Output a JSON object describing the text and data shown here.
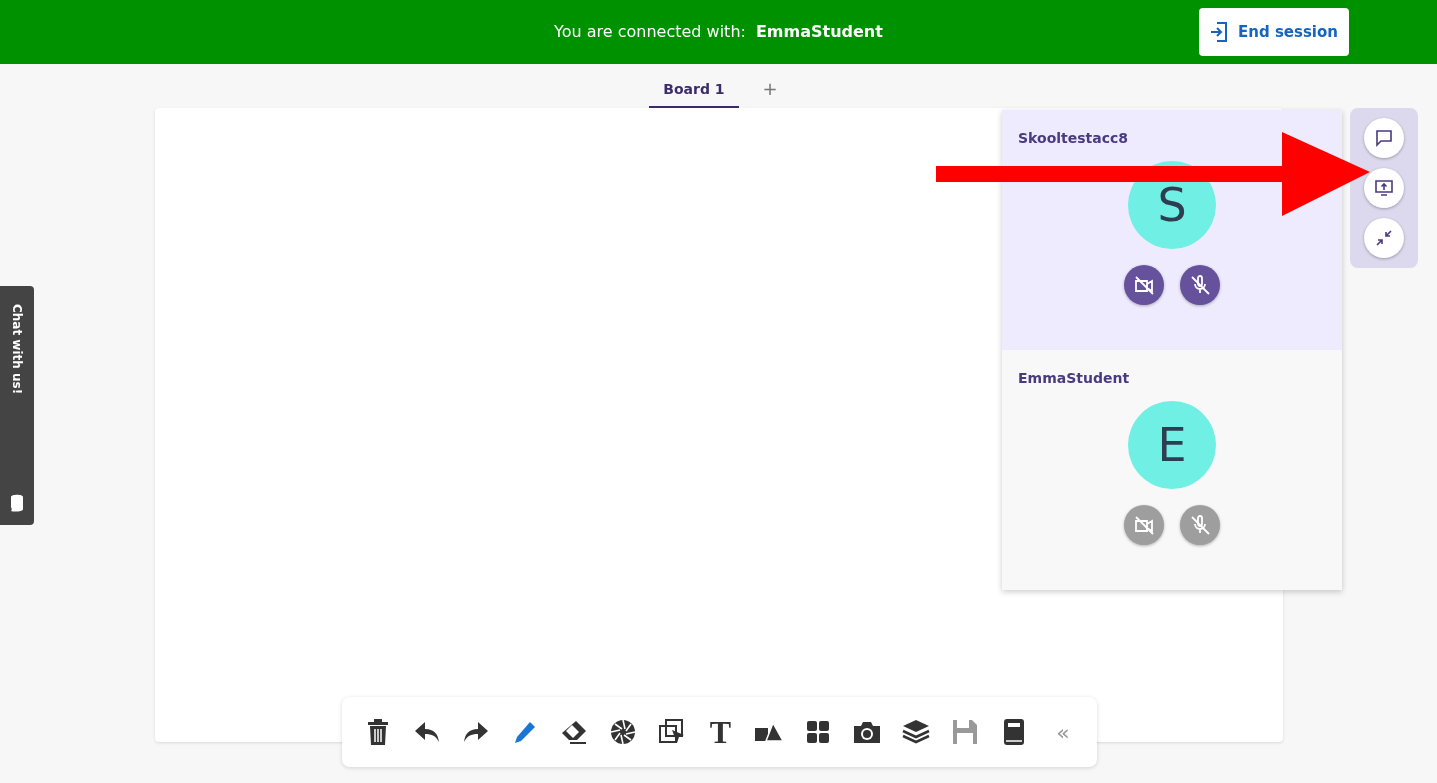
{
  "session_bar": {
    "label": "You are connected with:",
    "partner": "EmmaStudent",
    "end_button": "End session"
  },
  "board_tabs": [
    {
      "label": "Board 1",
      "selected": true
    }
  ],
  "add_tab": "+",
  "chat_widget": {
    "label": "Chat with us!"
  },
  "participants": [
    {
      "name": "Skooltestacc8",
      "initial": "S",
      "active": true,
      "camera_on": false,
      "mic_on": false
    },
    {
      "name": "EmmaStudent",
      "initial": "E",
      "active": false,
      "camera_on": false,
      "mic_on": false
    }
  ],
  "side_actions": [
    {
      "kind": "chat"
    },
    {
      "kind": "share_screen"
    },
    {
      "kind": "minimize"
    }
  ],
  "annotation": {
    "kind": "arrow"
  },
  "tools": [
    {
      "kind": "trash",
      "selected": false,
      "disabled": false
    },
    {
      "kind": "undo",
      "selected": false,
      "disabled": false
    },
    {
      "kind": "redo",
      "selected": false,
      "disabled": false
    },
    {
      "kind": "pencil",
      "selected": true,
      "disabled": false
    },
    {
      "kind": "eraser",
      "selected": false,
      "disabled": false
    },
    {
      "kind": "aperture",
      "selected": false,
      "disabled": false
    },
    {
      "kind": "select",
      "selected": false,
      "disabled": false
    },
    {
      "kind": "text",
      "glyph": "T",
      "selected": false,
      "disabled": false
    },
    {
      "kind": "shapes",
      "selected": false,
      "disabled": false
    },
    {
      "kind": "grid",
      "selected": false,
      "disabled": false
    },
    {
      "kind": "camera",
      "selected": false,
      "disabled": false
    },
    {
      "kind": "layers",
      "selected": false,
      "disabled": false
    },
    {
      "kind": "save",
      "selected": false,
      "disabled": true
    },
    {
      "kind": "book",
      "selected": false,
      "disabled": false
    },
    {
      "kind": "collapse",
      "glyph": "«",
      "selected": false,
      "disabled": false
    }
  ]
}
